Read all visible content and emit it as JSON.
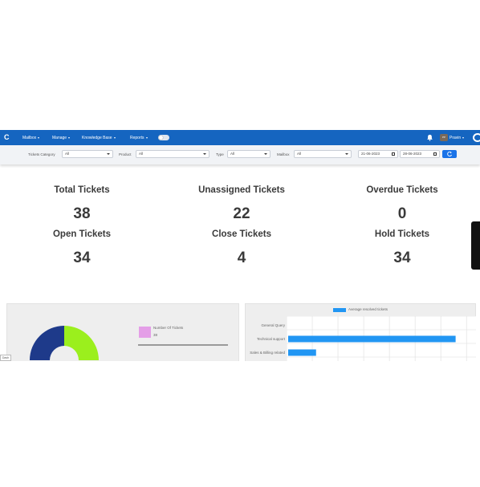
{
  "navbar": {
    "logo": "C",
    "menus": [
      {
        "label": "Mailbox"
      },
      {
        "label": "Manage"
      },
      {
        "label": "Knowledge Base"
      },
      {
        "label": "Reports"
      }
    ],
    "avatar_initials": "PP",
    "user_name": "Pravin",
    "brand_color": "#1565c0"
  },
  "filters": {
    "category_label": "Tickets Category",
    "category_value": "All",
    "product_label": "Product",
    "product_value": "All",
    "type_label": "Type",
    "type_value": "All",
    "mailbox_label": "Mailbox",
    "mailbox_value": "All",
    "date_from": "21-06-2023",
    "date_to": "28-06-2023"
  },
  "stats": [
    {
      "title": "Total Tickets",
      "value": "38"
    },
    {
      "title": "Unassigned Tickets",
      "value": "22"
    },
    {
      "title": "Overdue Tickets",
      "value": "0"
    },
    {
      "title": "Open Tickets",
      "value": "34"
    },
    {
      "title": "Close Tickets",
      "value": "4"
    },
    {
      "title": "Hold Tickets",
      "value": "34"
    }
  ],
  "donut": {
    "legend_label": "Number Of Tickets",
    "legend_value": "38",
    "badge": "Dash",
    "colors": [
      "#1e3a8a",
      "#9bef1d"
    ],
    "legend_color": "#e49ee7"
  },
  "chart_data": {
    "type": "bar",
    "orientation": "horizontal",
    "series": [
      {
        "name": "Average resolved tickets",
        "values": [
          0,
          6,
          1
        ]
      }
    ],
    "categories": [
      "General Query",
      "Technical support",
      "Sales & Billing related"
    ],
    "xlim": [
      0,
      6.5
    ],
    "grid": true,
    "legend": "top",
    "color": "#2196f3"
  }
}
